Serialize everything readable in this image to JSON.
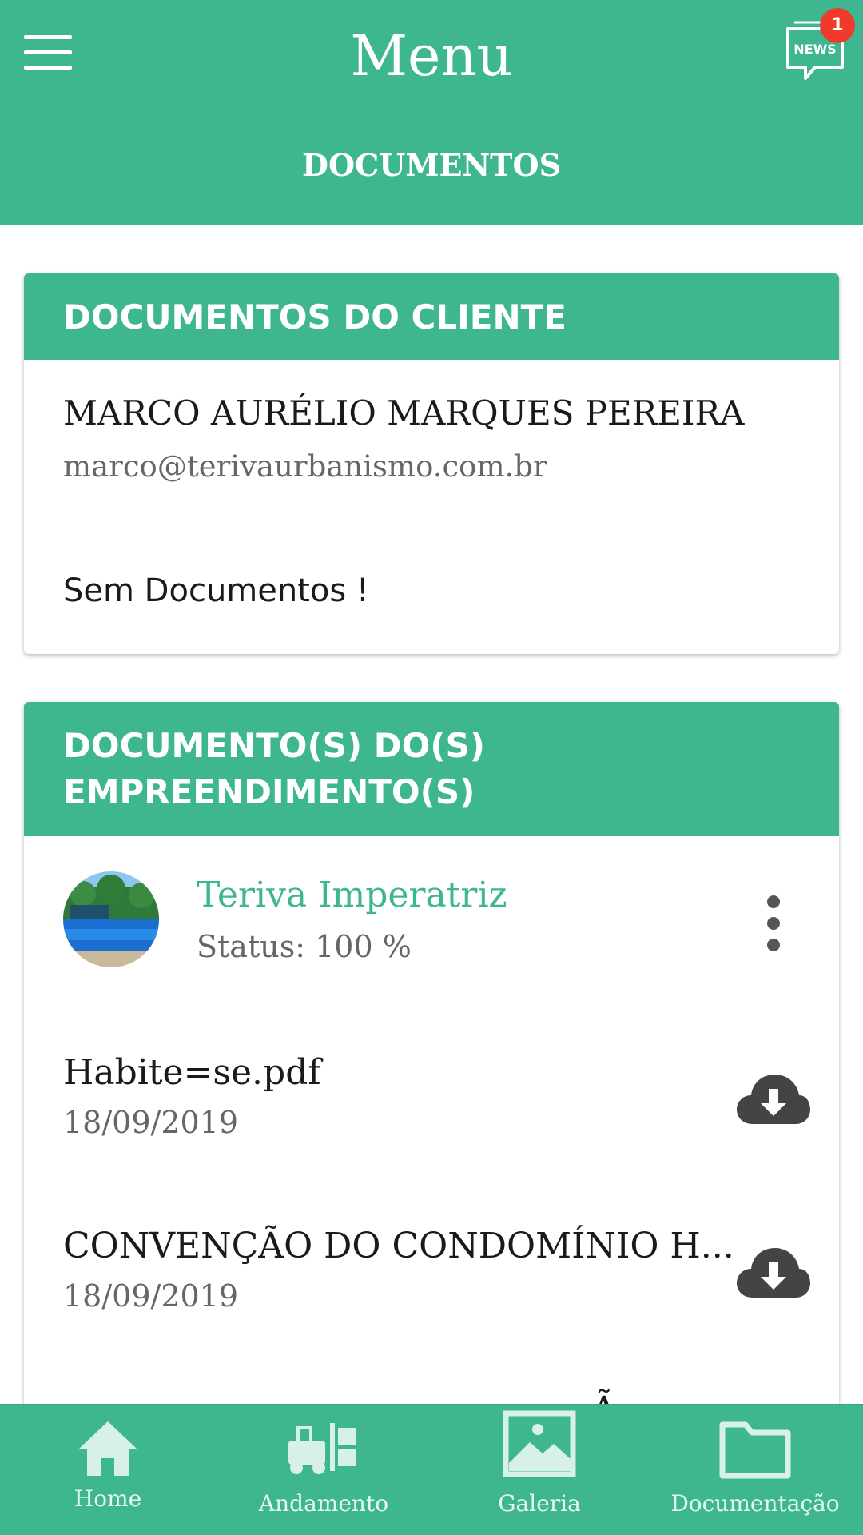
{
  "header": {
    "title": "Menu",
    "subtitle": "DOCUMENTOS",
    "news_label": "NEWS",
    "news_count": "1"
  },
  "client_card": {
    "title": "DOCUMENTOS DO CLIENTE",
    "name": "MARCO AURÉLIO MARQUES PEREIRA",
    "email": "marco@terivaurbanismo.com.br",
    "empty_message": "Sem Documentos !"
  },
  "projects_card": {
    "title_line1": "DOCUMENTO(S) DO(S)",
    "title_line2": "EMPREENDIMENTO(S)",
    "project": {
      "name": "Teriva Imperatriz",
      "status": "Status: 100 %"
    },
    "documents": [
      {
        "name": "Habite=se.pdf",
        "date": "18/09/2019"
      },
      {
        "name": "CONVENÇÃO DO CONDOMÍNIO H...",
        "date": "18/09/2019"
      }
    ],
    "partial_text": "Ã"
  },
  "bottom_nav": {
    "items": [
      {
        "label": "Home",
        "icon": "home-icon"
      },
      {
        "label": "Andamento",
        "icon": "forklift-icon"
      },
      {
        "label": "Galeria",
        "icon": "image-icon"
      },
      {
        "label": "Documentação",
        "icon": "folder-icon"
      }
    ]
  },
  "colors": {
    "primary": "#3eb68f",
    "badge": "#f03a2c",
    "icon_dark": "#444444"
  }
}
